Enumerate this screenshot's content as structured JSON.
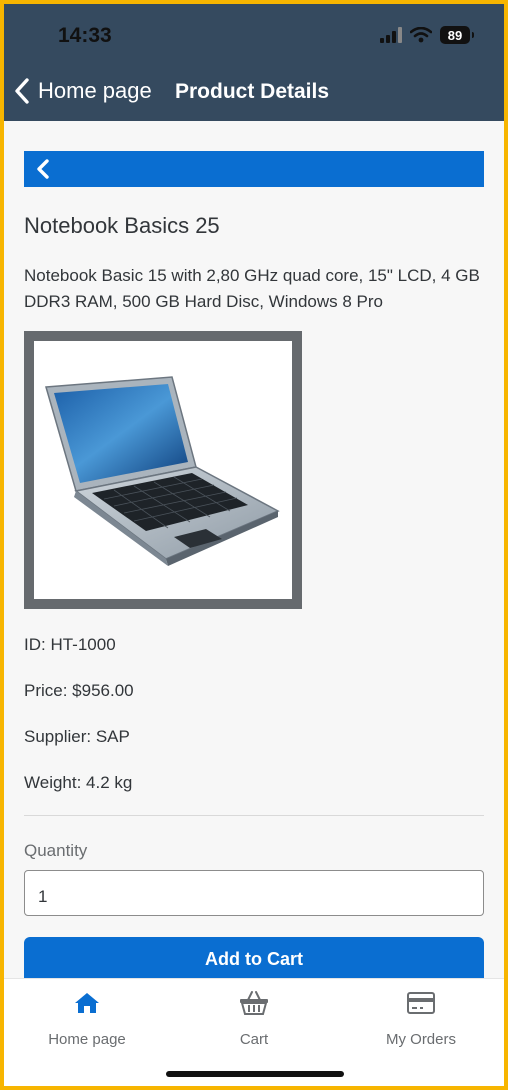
{
  "status": {
    "time": "14:33",
    "battery": "89"
  },
  "header": {
    "back_label": "Home page",
    "title": "Product Details"
  },
  "product": {
    "name": "Notebook Basics 25",
    "description": "Notebook Basic 15 with 2,80 GHz quad core, 15\" LCD, 4 GB DDR3 RAM, 500 GB Hard Disc, Windows 8 Pro",
    "id_text": "ID: HT-1000",
    "price_text": "Price: $956.00",
    "supplier_text": "Supplier: SAP",
    "weight_text": "Weight: 4.2 kg"
  },
  "form": {
    "quantity_label": "Quantity",
    "quantity_value": "1",
    "add_button": "Add to Cart"
  },
  "tabs": [
    {
      "label": "Home page",
      "icon": "home-icon",
      "active": true
    },
    {
      "label": "Cart",
      "icon": "basket-icon",
      "active": false
    },
    {
      "label": "My Orders",
      "icon": "card-icon",
      "active": false
    }
  ],
  "colors": {
    "header_bg": "#354a5f",
    "accent": "#0a6ed1",
    "frame": "#f7b500"
  }
}
